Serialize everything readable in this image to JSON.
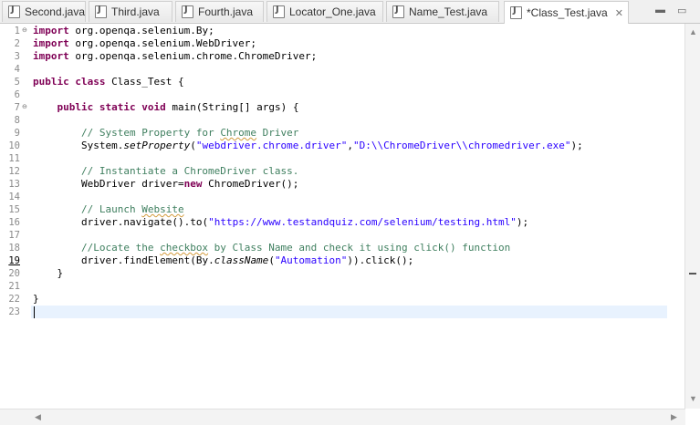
{
  "tabs": [
    {
      "label": "Second.java"
    },
    {
      "label": "Third.java"
    },
    {
      "label": "Fourth.java"
    },
    {
      "label": "Locator_One.java"
    },
    {
      "label": "Name_Test.java"
    },
    {
      "label": "*Class_Test.java",
      "active": true
    }
  ],
  "window_controls": {
    "minimize": "▬",
    "restore": "▭"
  },
  "line_numbers": [
    "1",
    "2",
    "3",
    "4",
    "5",
    "6",
    "7",
    "8",
    "9",
    "10",
    "11",
    "12",
    "13",
    "14",
    "15",
    "16",
    "17",
    "18",
    "19",
    "20",
    "21",
    "22",
    "23"
  ],
  "code": {
    "l1": {
      "kw": "import",
      "rest": " org.openqa.selenium.By;"
    },
    "l2": {
      "kw": "import",
      "rest": " org.openqa.selenium.WebDriver;"
    },
    "l3": {
      "kw": "import",
      "rest": " org.openqa.selenium.chrome.ChromeDriver;"
    },
    "l5": {
      "kw1": "public",
      "kw2": "class",
      "rest": " Class_Test {"
    },
    "l7": {
      "kw1": "public",
      "kw2": "static",
      "kw3": "void",
      "rest": " main(String[] args) {"
    },
    "l9": {
      "cmt_a": "// System Property for ",
      "cmt_b": "Chrome",
      "cmt_c": " Driver"
    },
    "l10": {
      "a": "System.",
      "m": "setProperty",
      "b": "(",
      "s1": "\"webdriver.chrome.driver\"",
      "c": ",",
      "s2": "\"D:\\\\ChromeDriver\\\\chromedriver.exe\"",
      "d": ");"
    },
    "l12": {
      "cmt": "// Instantiate a ChromeDriver class."
    },
    "l13": {
      "a": "WebDriver ",
      "v": "driver",
      "b": "=",
      "kw": "new",
      "c": " ChromeDriver();"
    },
    "l15": {
      "cmt_a": "// Launch ",
      "cmt_b": "Website"
    },
    "l16": {
      "v": "driver",
      "a": ".navigate().to(",
      "s": "\"https://www.testandquiz.com/selenium/testing.html\"",
      "b": ");"
    },
    "l18": {
      "cmt_a": "//Locate the ",
      "cmt_b": "checkbox",
      "cmt_c": " by Class Name and check it using click() function"
    },
    "l19": {
      "v": "driver",
      "a": ".findElement(By.",
      "m": "className",
      "b": "(",
      "s": "\"Automation\"",
      "c": ")).click();"
    },
    "l20": {
      "rest": "}"
    },
    "l22": {
      "rest": "}"
    }
  }
}
